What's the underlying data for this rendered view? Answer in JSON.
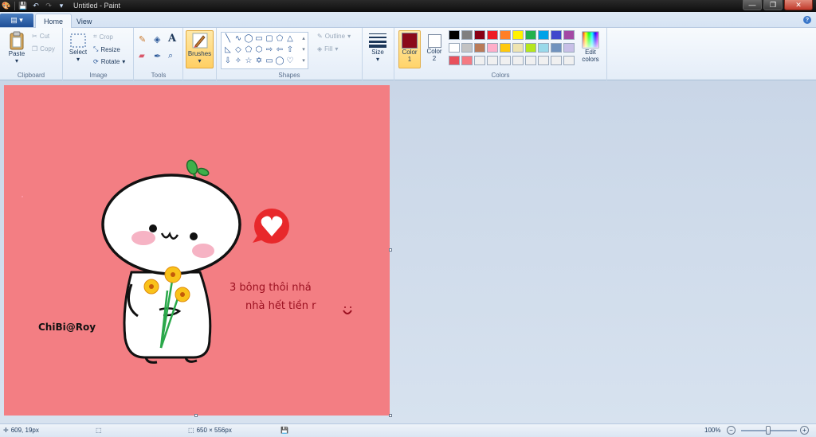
{
  "titlebar": {
    "title": "Untitled - Paint",
    "minimize": "—",
    "maximize": "❐",
    "close": "✕"
  },
  "tabs": {
    "app_menu": "▤ ▾",
    "home": "Home",
    "view": "View",
    "help": "?"
  },
  "ribbon": {
    "clipboard": {
      "paste": "Paste",
      "cut": "Cut",
      "copy": "Copy",
      "label": "Clipboard"
    },
    "image": {
      "select": "Select",
      "crop": "Crop",
      "resize": "Resize",
      "rotate": "Rotate",
      "label": "Image"
    },
    "tools": {
      "label": "Tools",
      "text_tool": "A"
    },
    "brushes": {
      "label": "Brushes"
    },
    "shapes": {
      "outline": "Outline",
      "fill": "Fill",
      "label": "Shapes"
    },
    "size": {
      "label": "Size"
    },
    "colors": {
      "color1": "Color",
      "color1_num": "1",
      "color2": "Color",
      "color2_num": "2",
      "edit": "Edit",
      "edit2": "colors",
      "label": "Colors",
      "color1_value": "#8b0a1a",
      "color2_value": "#ffffff",
      "palette_row1": [
        "#000000",
        "#7f7f7f",
        "#880015",
        "#ed1c24",
        "#ff7f27",
        "#fff200",
        "#22b14c",
        "#00a2e8",
        "#3f48cc",
        "#a349a4"
      ],
      "palette_row2": [
        "#ffffff",
        "#c3c3c3",
        "#b97a57",
        "#ffaec9",
        "#ffc90e",
        "#efe4b0",
        "#b5e61d",
        "#99d9ea",
        "#7092be",
        "#c8bfe7"
      ],
      "palette_row3": [
        "#e8505b",
        "#f47a82",
        "#f0f0f0",
        "#f0f0f0",
        "#f0f0f0",
        "#f0f0f0",
        "#f0f0f0",
        "#f0f0f0",
        "#f0f0f0",
        "#f0f0f0"
      ]
    }
  },
  "canvas": {
    "background": "#f37e83",
    "text_line1": "3 bông thôi nhá",
    "text_line2": "nhà hết tiền r",
    "signature": "ChiBi@Roy"
  },
  "status": {
    "cursor_pos": "609, 19px",
    "canvas_size": "650 × 556px",
    "zoom": "100%"
  }
}
